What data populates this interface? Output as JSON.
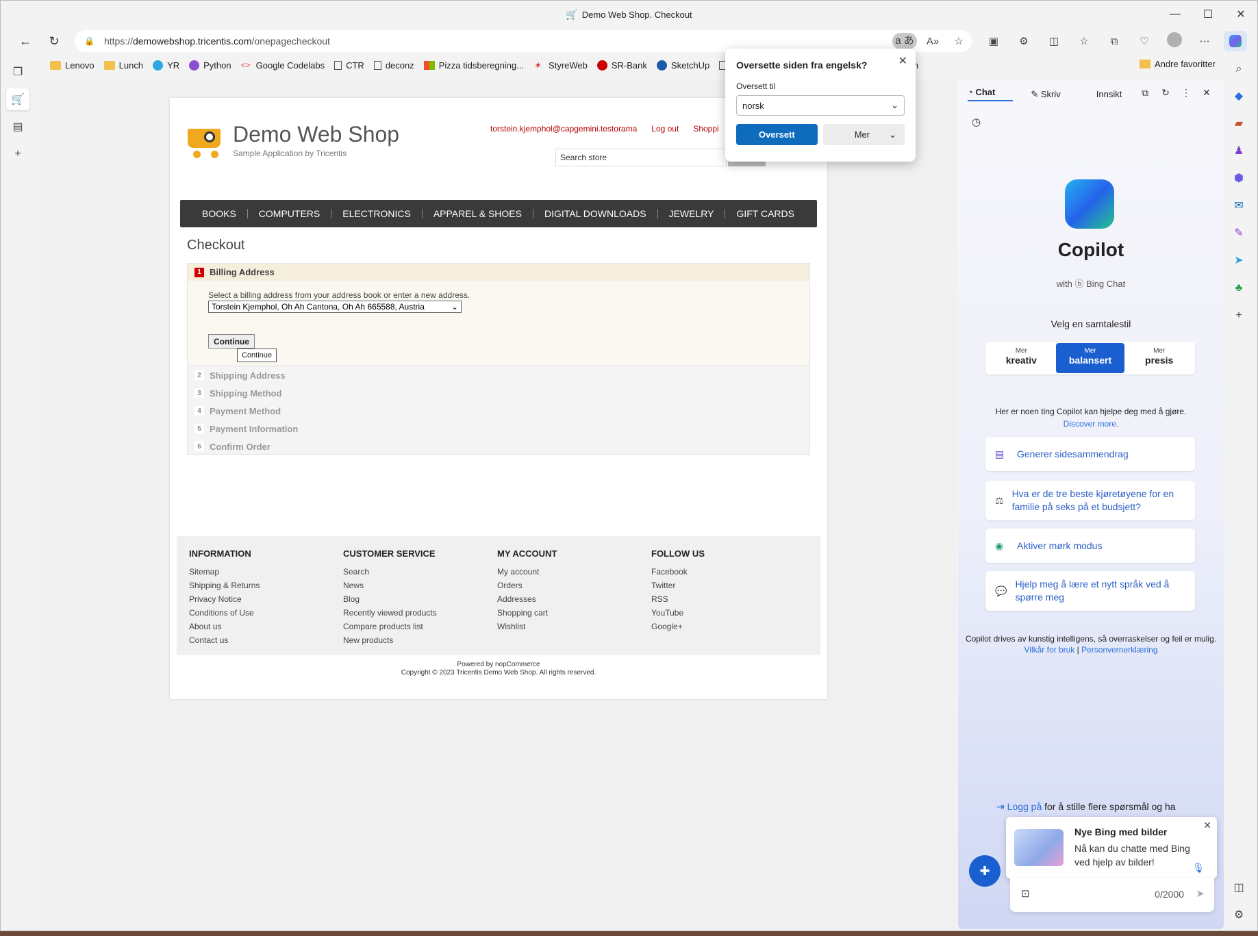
{
  "window": {
    "title": "Demo Web Shop. Checkout",
    "minimize": "—",
    "maximize": "☐",
    "close": "✕"
  },
  "nav": {
    "back": "←",
    "refresh": "↻",
    "url_prefix": "https://",
    "url_host": "demowebshop.tricentis.com",
    "url_path": "/onepagecheckout"
  },
  "favorites": [
    "Lenovo",
    "Lunch",
    "YR",
    "Python",
    "Google Codelabs",
    "CTR",
    "deconz",
    "Pizza tidsberegning...",
    "StyreWeb",
    "SR-Bank",
    "SketchUp",
    "sjon"
  ],
  "favorites_right": "Andre favoritter",
  "site": {
    "logo_title": "Demo Web Shop",
    "logo_sub": "Sample Application by Tricentis",
    "user_email": "torstein.kjemphol@capgemini.testorama",
    "logout": "Log out",
    "shopping": "Shoppi",
    "search_placeholder": "Search store",
    "menu": [
      "BOOKS",
      "COMPUTERS",
      "ELECTRONICS",
      "APPAREL & SHOES",
      "DIGITAL DOWNLOADS",
      "JEWELRY",
      "GIFT CARDS"
    ],
    "checkout_title": "Checkout",
    "step1": {
      "num": "1",
      "label": "Billing Address",
      "hint": "Select a billing address from your address book or enter a new address.",
      "selected_address": "Torstein Kjemphol, Oh Ah Cantona, Oh Ah 665588, Austria",
      "continue": "Continue",
      "tooltip": "Continue"
    },
    "steps": [
      {
        "num": "2",
        "label": "Shipping Address"
      },
      {
        "num": "3",
        "label": "Shipping Method"
      },
      {
        "num": "4",
        "label": "Payment Method"
      },
      {
        "num": "5",
        "label": "Payment Information"
      },
      {
        "num": "6",
        "label": "Confirm Order"
      }
    ],
    "footer": [
      {
        "title": "INFORMATION",
        "links": [
          "Sitemap",
          "Shipping & Returns",
          "Privacy Notice",
          "Conditions of Use",
          "About us",
          "Contact us"
        ]
      },
      {
        "title": "CUSTOMER SERVICE",
        "links": [
          "Search",
          "News",
          "Blog",
          "Recently viewed products",
          "Compare products list",
          "New products"
        ]
      },
      {
        "title": "MY ACCOUNT",
        "links": [
          "My account",
          "Orders",
          "Addresses",
          "Shopping cart",
          "Wishlist"
        ]
      },
      {
        "title": "FOLLOW US",
        "links": [
          "Facebook",
          "Twitter",
          "RSS",
          "YouTube",
          "Google+"
        ]
      }
    ],
    "powered": "Powered by nopCommerce",
    "copyright": "Copyright © 2023 Tricentis Demo Web Shop. All rights reserved."
  },
  "translate": {
    "title": "Oversette siden fra engelsk?",
    "label": "Oversett til",
    "language": "norsk",
    "ok": "Oversett",
    "more": "Mer"
  },
  "copilot": {
    "tabs": [
      "Chat",
      "Skriv",
      "Innsikt"
    ],
    "name": "Copilot",
    "with": "with",
    "bing": "Bing Chat",
    "velg": "Velg en samtalestil",
    "styles": [
      {
        "top": "Mer",
        "main": "kreativ"
      },
      {
        "top": "Mer",
        "main": "balansert"
      },
      {
        "top": "Mer",
        "main": "presis"
      }
    ],
    "help": "Her er noen ting Copilot kan hjelpe deg med å gjøre.",
    "discover": "Discover more.",
    "cards": [
      "Generer sidesammendrag",
      "Hva er de tre beste kjøretøyene for en familie på seks på et budsjett?",
      "Aktiver mørk modus",
      "Hjelp meg å lære et nytt språk ved å spørre meg"
    ],
    "disclaimer": "Copilot drives av kunstig intelligens, så overraskelser og feil er mulig.",
    "terms": "Vilkår for bruk",
    "privacy": "Personvernerklæring",
    "login_link": "Logg på",
    "login_rest": "for å stille flere spørsmål og ha",
    "toast_title": "Nye Bing med bilder",
    "toast_body": "Nå kan du chatte med Bing ved hjelp av bilder!",
    "counter": "0/2000"
  }
}
